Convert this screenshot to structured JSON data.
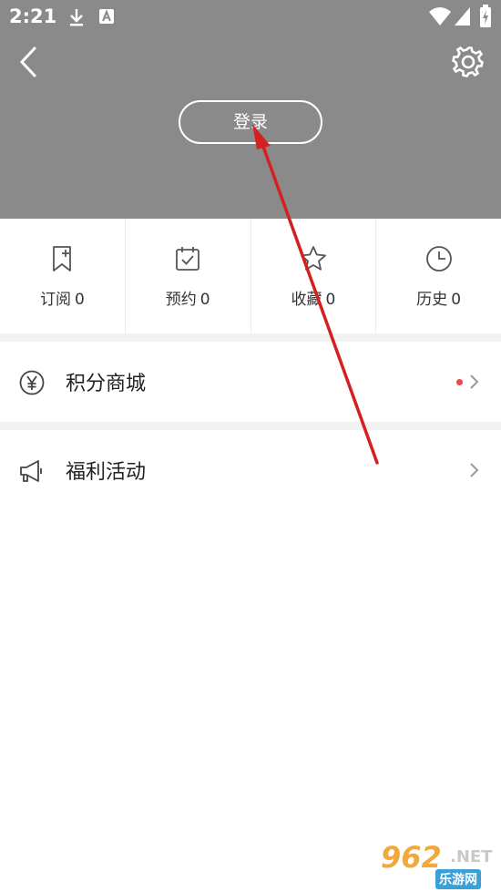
{
  "status_bar": {
    "time": "2:21",
    "icons": [
      "download-icon",
      "a-notification-icon",
      "wifi-icon",
      "signal-icon",
      "battery-icon"
    ]
  },
  "header": {
    "back_icon": "chevron-left-icon",
    "settings_icon": "gear-icon",
    "login_label": "登录",
    "background_color": "#8a8a8a"
  },
  "stats": [
    {
      "icon": "bookmark-add-icon",
      "label": "订阅",
      "count": "0"
    },
    {
      "icon": "calendar-check-icon",
      "label": "预约",
      "count": "0"
    },
    {
      "icon": "star-icon",
      "label": "收藏",
      "count": "0"
    },
    {
      "icon": "clock-icon",
      "label": "历史",
      "count": "0"
    }
  ],
  "menu": [
    {
      "icon": "yen-coin-icon",
      "label": "积分商城",
      "has_dot": true
    },
    {
      "icon": "megaphone-icon",
      "label": "福利活动",
      "has_dot": false
    }
  ],
  "watermark": {
    "number": "962",
    "suffix": ".NET",
    "chinese": "乐游网"
  },
  "colors": {
    "accent_red": "#f0454b",
    "annotation_arrow": "#d42020"
  }
}
